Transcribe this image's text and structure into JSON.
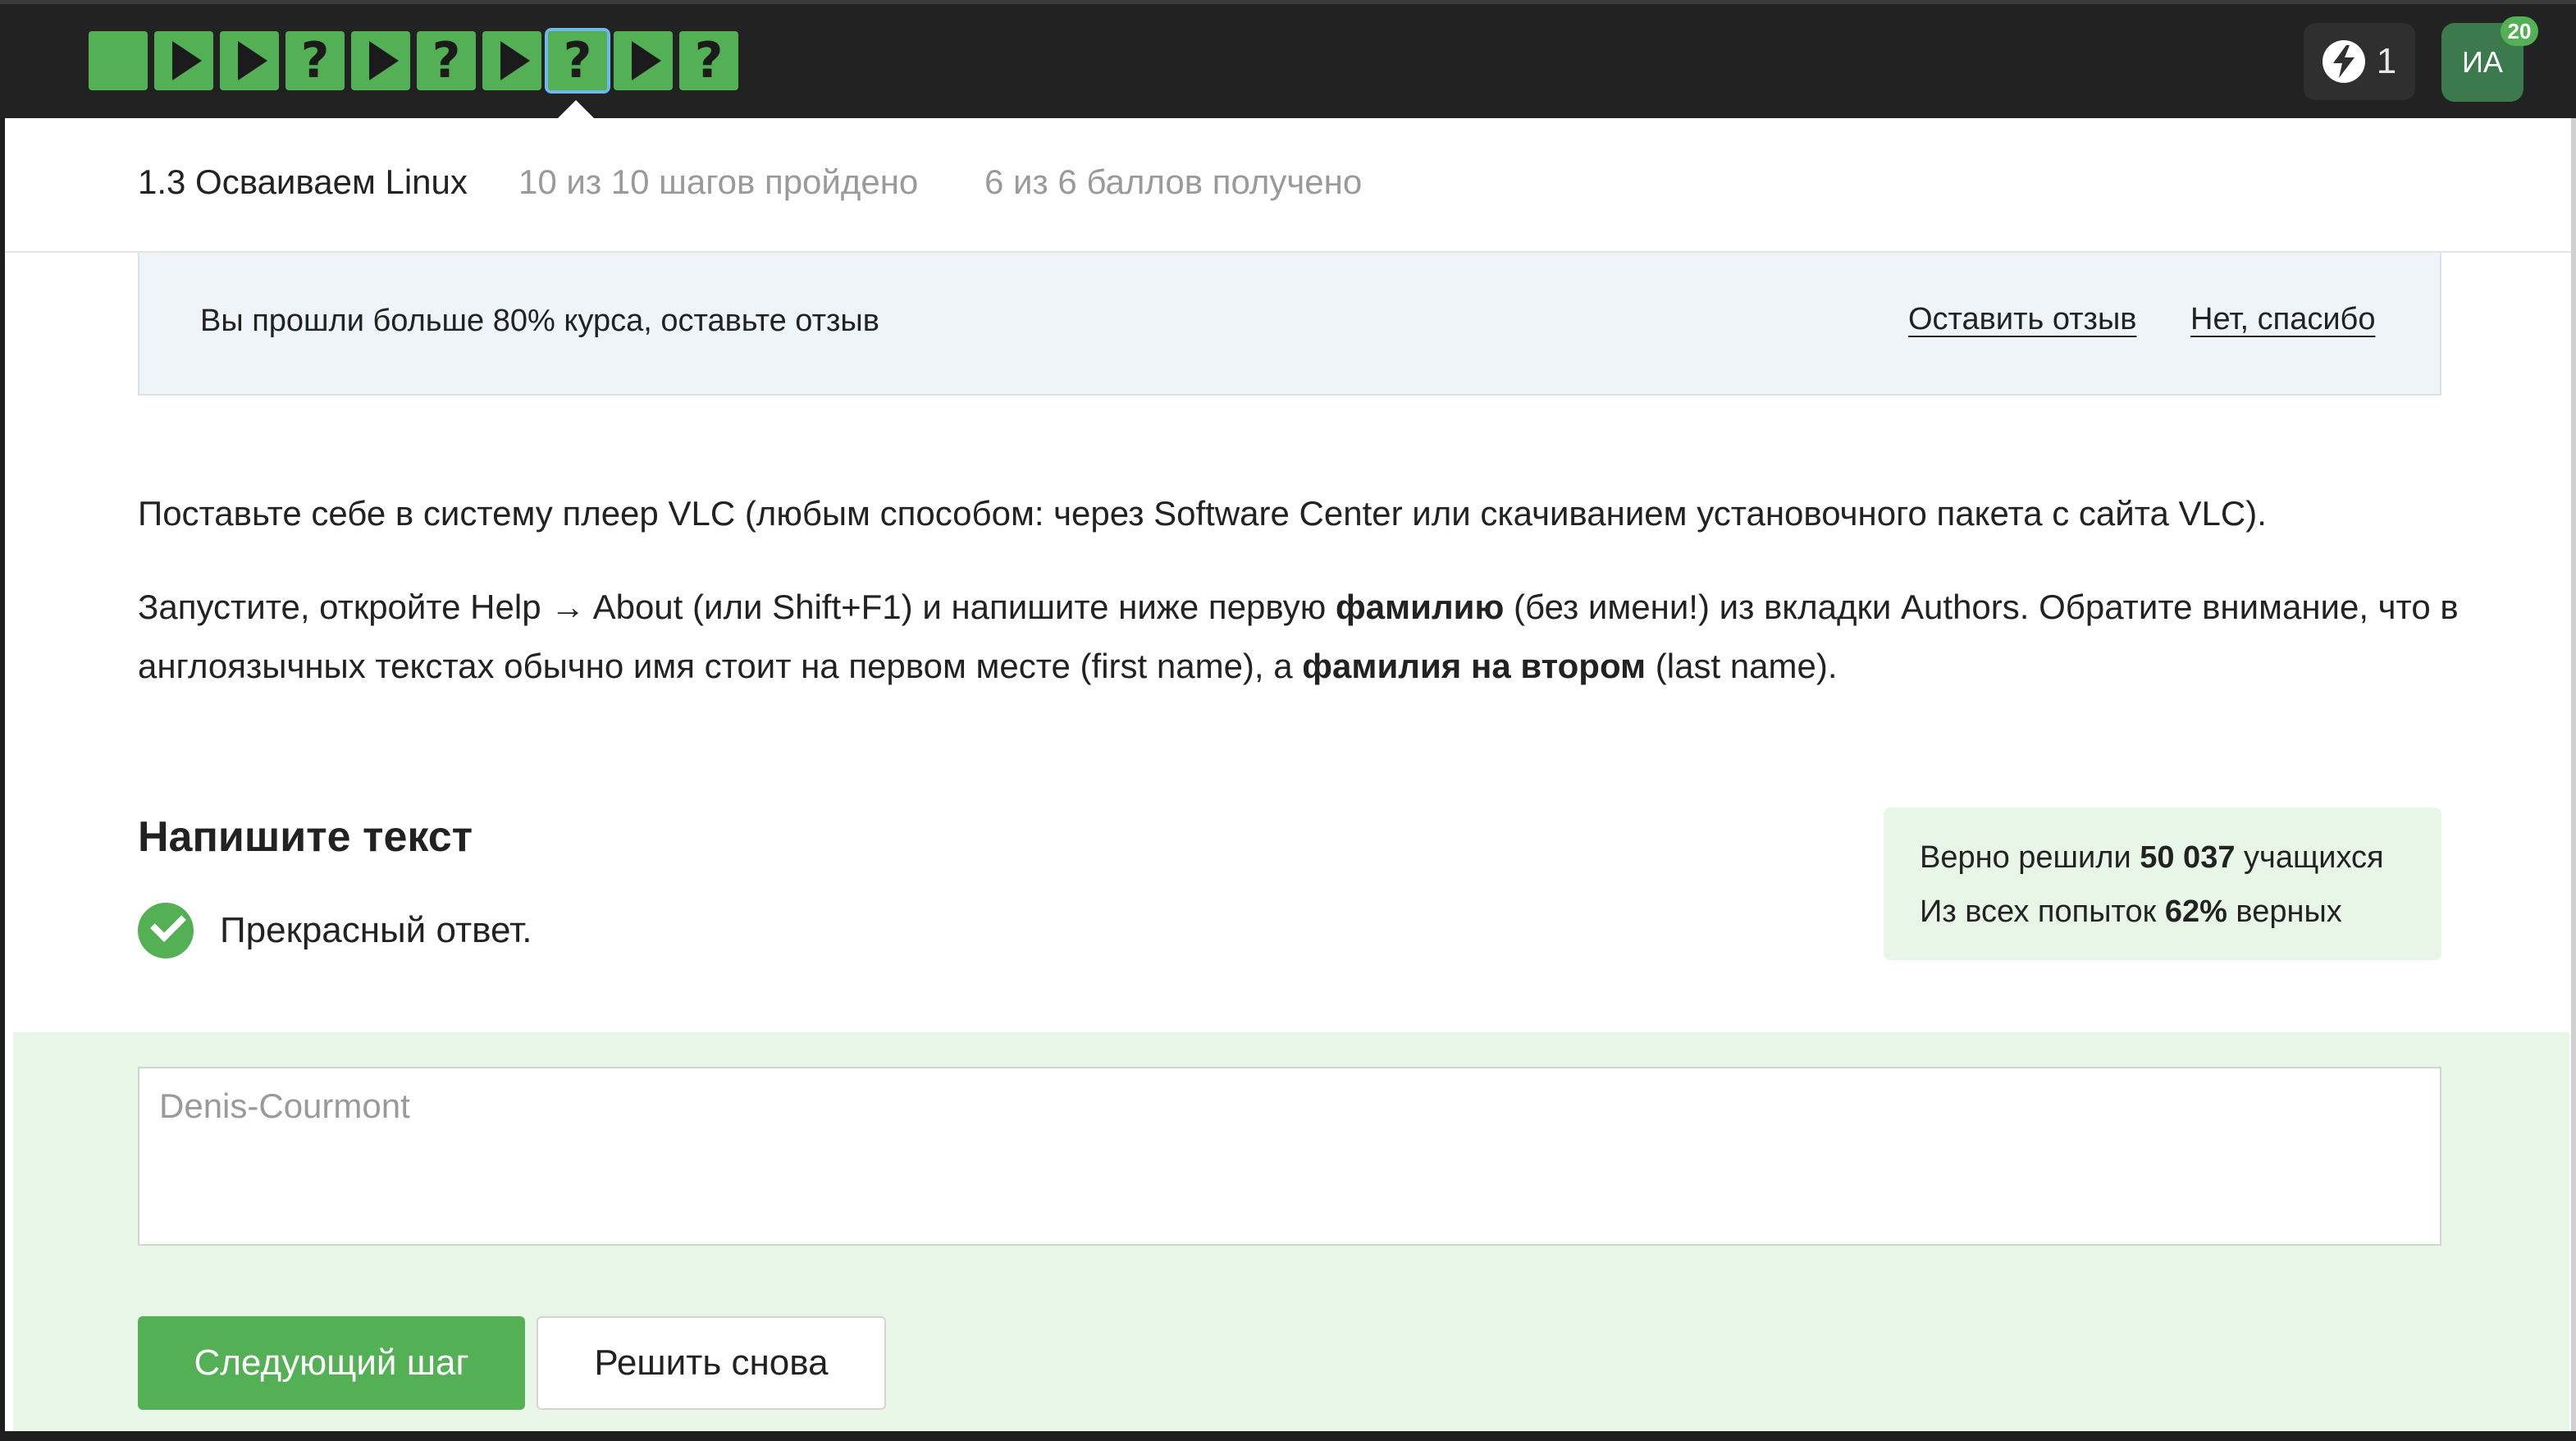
{
  "step_bar": {
    "steps": [
      {
        "kind": "text"
      },
      {
        "kind": "video"
      },
      {
        "kind": "video"
      },
      {
        "kind": "quiz"
      },
      {
        "kind": "video"
      },
      {
        "kind": "quiz"
      },
      {
        "kind": "video"
      },
      {
        "kind": "quiz",
        "active": true
      },
      {
        "kind": "video"
      },
      {
        "kind": "quiz"
      }
    ],
    "quiz_glyph": "?"
  },
  "user": {
    "energy_count": "1",
    "initials": "ИА",
    "notifications": "20"
  },
  "lesson": {
    "title": "1.3 Осваиваем Linux",
    "steps_progress": "10 из 10 шагов пройдено",
    "score": "6 из 6 баллов  получено"
  },
  "feedback_banner": {
    "text": "Вы прошли больше 80% курса, оставьте отзыв",
    "leave_review": "Оставить отзыв",
    "no_thanks": "Нет, спасибо"
  },
  "task": {
    "p1": "Поставьте себе в систему плеер VLC (любым способом: через Software Center или скачиванием установочного пакета с сайта VLC).",
    "p2_a": "Запустите, откройте Help → About (или Shift+F1) и напишите ниже первую ",
    "p2_b": "фамилию",
    "p2_c": " (без имени!) из вкладки Authors. Обратите внимание, что в англоязычных текстах обычно имя стоит на первом месте (first name), а ",
    "p2_d": "фамилия на втором",
    "p2_e": " (last name)."
  },
  "answer": {
    "heading": "Напишите текст",
    "feedback": "Прекрасный ответ.",
    "value": "Denis-Courmont"
  },
  "stats": {
    "solved_prefix": "Верно решили ",
    "solved_count": "50 037",
    "solved_suffix": " учащихся",
    "attempts_prefix": "Из всех попыток ",
    "attempts_pct": "62%",
    "attempts_suffix": " верных"
  },
  "buttons": {
    "next": "Следующий шаг",
    "retry": "Решить снова"
  },
  "colors": {
    "topbar": "#222222",
    "step_green": "#54b055",
    "active_outline": "#70b7ec",
    "success_bg": "#e8f6e8",
    "banner_bg": "#eef4f8"
  }
}
